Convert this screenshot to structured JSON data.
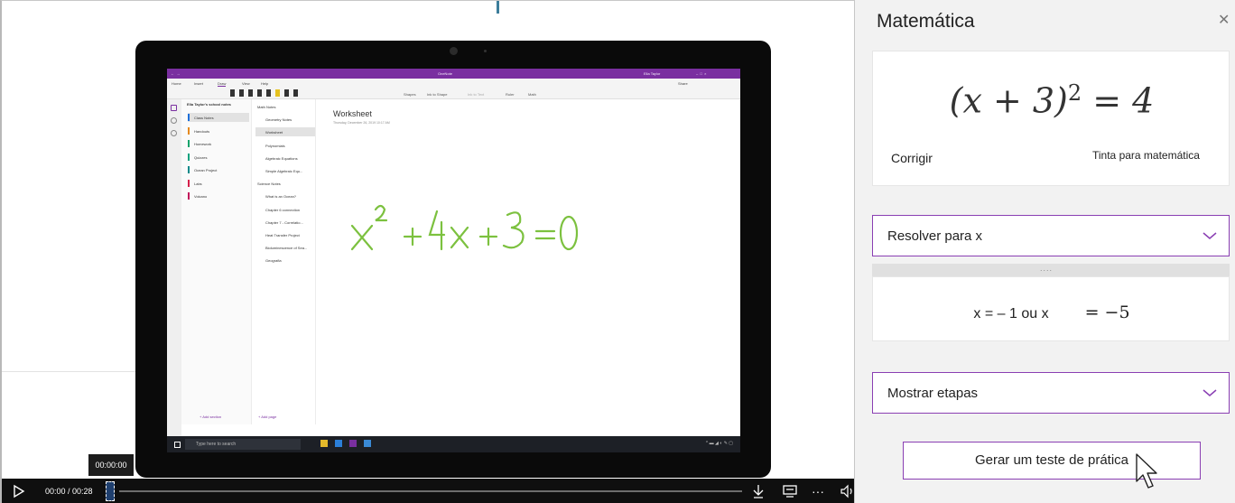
{
  "video": {
    "current_time_tip": "00:00:00",
    "time_display": "00:00 / 00:28",
    "controls": [
      "download-icon",
      "captions-icon",
      "more-icon",
      "volume-icon"
    ]
  },
  "onenote": {
    "title": "OneNote",
    "user": "Ella Taylor",
    "tabs": [
      "Home",
      "Insert",
      "Draw",
      "View",
      "Help"
    ],
    "active_tab": "Draw",
    "tools": [
      "Shapes",
      "Ink to Shape",
      "Ink to Text",
      "Ruler",
      "Math"
    ],
    "share": "Share",
    "notebook": "Ella Taylor's school notes",
    "sections": [
      {
        "label": "Class Notes",
        "color": "#1e6fd9",
        "selected": true
      },
      {
        "label": "Handouts",
        "color": "#e58a1f",
        "selected": false
      },
      {
        "label": "Homework",
        "color": "#14a36b",
        "selected": false
      },
      {
        "label": "Quizzes",
        "color": "#12a37f",
        "selected": false
      },
      {
        "label": "Ocean Project",
        "color": "#0e8a8a",
        "selected": false
      },
      {
        "label": "Labs",
        "color": "#d6204b",
        "selected": false
      },
      {
        "label": "Volcano",
        "color": "#c2185b",
        "selected": false
      }
    ],
    "pages": [
      {
        "label": "Math Notes",
        "group": true
      },
      {
        "label": "Geometry Notes",
        "group": false
      },
      {
        "label": "Worksheet",
        "group": false,
        "selected": true
      },
      {
        "label": "Polynomials",
        "group": false
      },
      {
        "label": "Algebraic Equations",
        "group": false
      },
      {
        "label": "Simple Algebraic Equ...",
        "group": false
      },
      {
        "label": "Science Notes",
        "group": true
      },
      {
        "label": "What is an Ocean?",
        "group": false
      },
      {
        "label": "Chapter 6 connection",
        "group": false
      },
      {
        "label": "Chapter 7 - Correlatio...",
        "group": false
      },
      {
        "label": "Heat Transfer Project",
        "group": false
      },
      {
        "label": "Bioluminescence of Sea...",
        "group": false
      },
      {
        "label": "Geografia",
        "group": false
      }
    ],
    "add_section": "+ Add section",
    "add_page": "+ Add page",
    "page_title": "Worksheet",
    "page_date": "Thursday, December 26, 2019      10:17 AM",
    "ink_equation": "x² + 4x + 3 = 0",
    "ink_color": "#7cc13f",
    "taskbar_search": "Type here to search"
  },
  "math_pane": {
    "title": "Matemática",
    "equation_base": "(x + 3)",
    "equation_exp": "2",
    "equation_rhs": " = 4",
    "fix_label": "Corrigir",
    "ink_math_label": "Tinta para matemática",
    "solve_dropdown": "Resolver para x",
    "grip": "....",
    "solution_left": "x = – 1 ou x",
    "solution_right": "= −5",
    "steps_dropdown": "Mostrar etapas",
    "practice_button": "Gerar um teste de prática",
    "accent_color": "#8a3fb3"
  }
}
